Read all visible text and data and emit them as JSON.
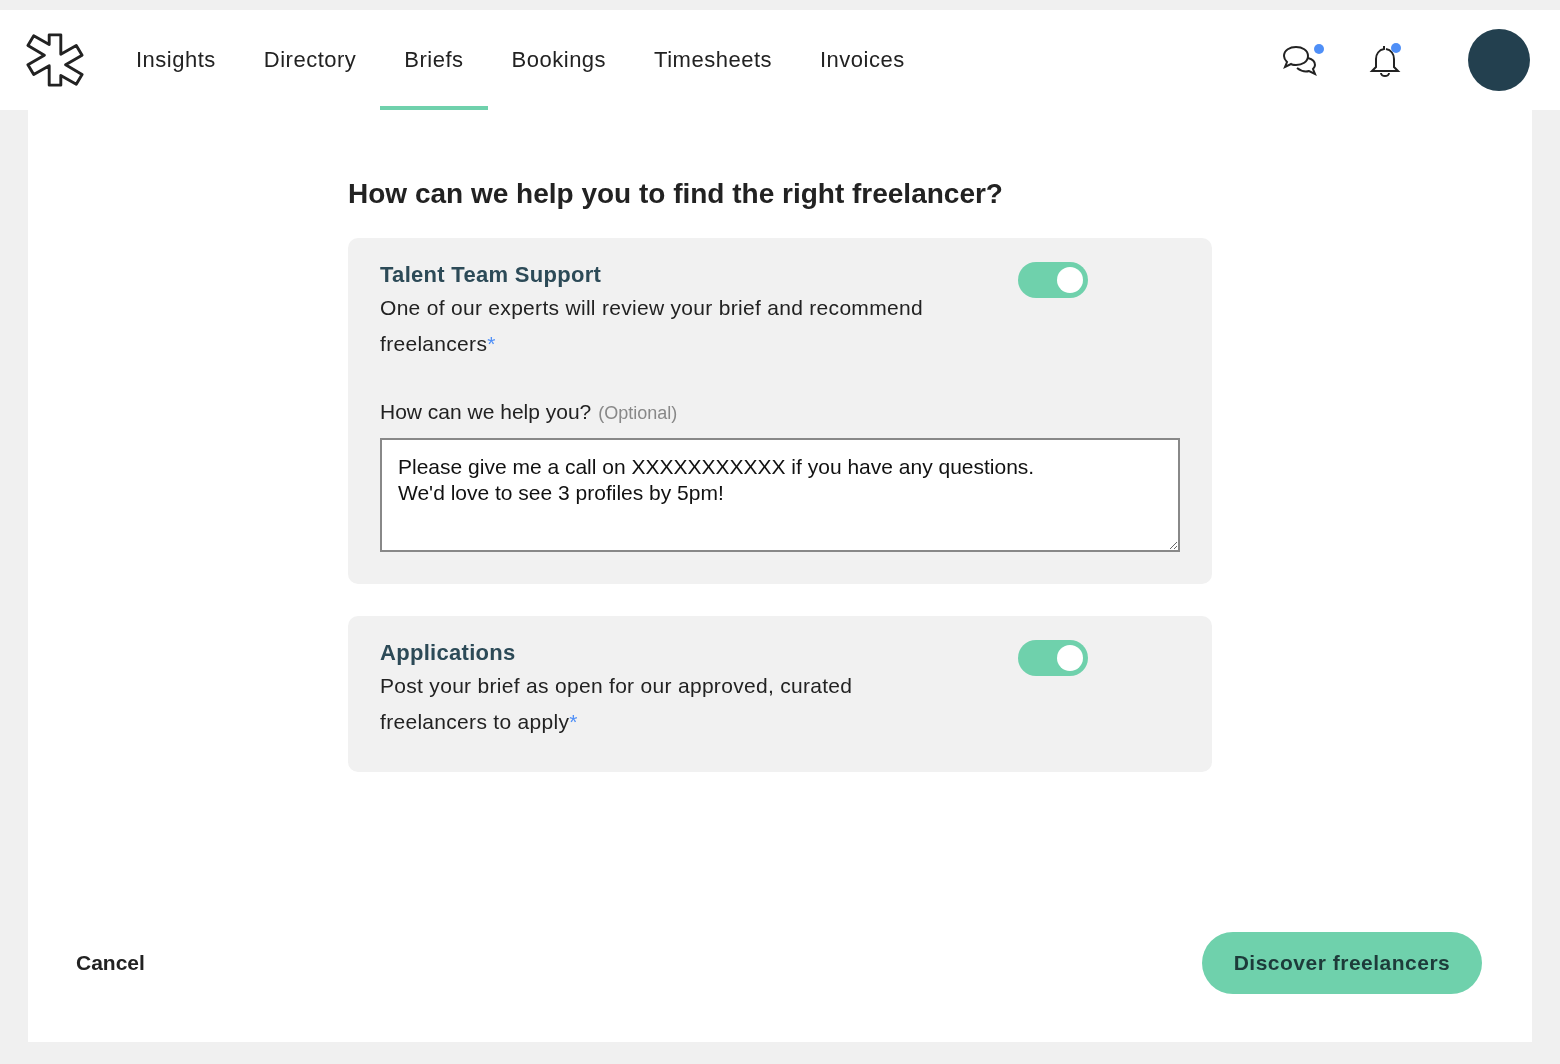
{
  "nav": {
    "tabs": [
      {
        "label": "Insights",
        "selected": false
      },
      {
        "label": "Directory",
        "selected": false
      },
      {
        "label": "Briefs",
        "selected": true
      },
      {
        "label": "Bookings",
        "selected": false
      },
      {
        "label": "Timesheets",
        "selected": false
      },
      {
        "label": "Invoices",
        "selected": false
      }
    ],
    "messages": {
      "unread": true
    },
    "notifications": {
      "unread": true
    }
  },
  "heading": "How can we help you to find the right freelancer?",
  "options": [
    {
      "kind": "with_input",
      "title": "Talent Team Support",
      "description": "One of our experts will review your brief and recommend freelancers",
      "mark": "*",
      "on": true,
      "field_label": "How can we help you?",
      "field_hint": "(Optional)",
      "value": "Please give me a call on XXXXXXXXXXX if you have any questions.\nWe'd love to see 3 profiles by 5pm!"
    },
    {
      "kind": "plain",
      "title": "Applications",
      "description": "Post your brief as open for our approved, curated freelancers to apply",
      "mark": "*",
      "on": true
    }
  ],
  "footer": {
    "cancel": "Cancel",
    "submit": "Discover freelancers"
  }
}
